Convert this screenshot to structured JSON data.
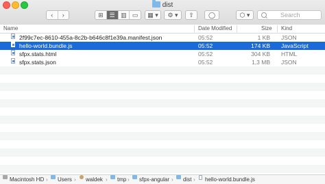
{
  "window": {
    "title": "dist"
  },
  "toolbar": {
    "back": "‹",
    "forward": "›",
    "view_icons": "⊞",
    "view_list": "☰",
    "view_columns": "▥",
    "view_gallery": "▭",
    "group": "▦ ▾",
    "action": "⚙ ▾",
    "share": "⇧",
    "tags": "◯",
    "dropbox": "⬡ ▾",
    "search_placeholder": "Search"
  },
  "columns": {
    "name": "Name",
    "date": "Date Modified",
    "size": "Size",
    "kind": "Kind"
  },
  "files": [
    {
      "name": "2f99c7ec-8610-455a-8c2b-b646c8f1e39a.manifest.json",
      "date": "05:52",
      "size": "1 KB",
      "kind": "JSON",
      "selected": false
    },
    {
      "name": "hello-world.bundle.js",
      "date": "05:52",
      "size": "174 KB",
      "kind": "JavaScript",
      "selected": true
    },
    {
      "name": "sfpx.stats.html",
      "date": "05:52",
      "size": "304 KB",
      "kind": "HTML",
      "selected": false
    },
    {
      "name": "sfpx.stats.json",
      "date": "05:52",
      "size": "1,3 MB",
      "kind": "JSON",
      "selected": false
    }
  ],
  "pathbar": [
    "Macintosh HD",
    "Users",
    "waldek",
    "tmp",
    "sfpx-angular",
    "dist",
    "hello-world.bundle.js"
  ],
  "colors": {
    "selection": "#1a6ad9",
    "folder": "#7fb9ec"
  }
}
